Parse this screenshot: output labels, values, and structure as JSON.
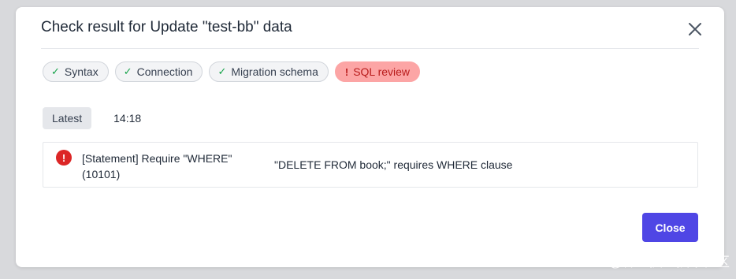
{
  "dialog": {
    "title": "Check result for Update \"test-bb\" data",
    "close_icon": "close-icon"
  },
  "checks": [
    {
      "label": "Syntax",
      "status": "success",
      "icon": "check-icon",
      "mark": "✓"
    },
    {
      "label": "Connection",
      "status": "success",
      "icon": "check-icon",
      "mark": "✓"
    },
    {
      "label": "Migration schema",
      "status": "success",
      "icon": "check-icon",
      "mark": "✓"
    },
    {
      "label": "SQL review",
      "status": "error",
      "icon": "exclamation-icon",
      "mark": "!"
    }
  ],
  "status_row": {
    "badge": "Latest",
    "time": "14:18"
  },
  "result": {
    "icon": "error-circle-icon",
    "icon_glyph": "!",
    "rule_title": "[Statement] Require \"WHERE\" (10101)",
    "message": "\"DELETE FROM book;\" requires WHERE clause"
  },
  "footer": {
    "close_label": "Close"
  },
  "watermark": "@稀土掘金技术社区",
  "colors": {
    "primary": "#4f46e5",
    "error": "#dc2626",
    "error_pill_bg": "#fca5a5",
    "success": "#16a34a"
  }
}
